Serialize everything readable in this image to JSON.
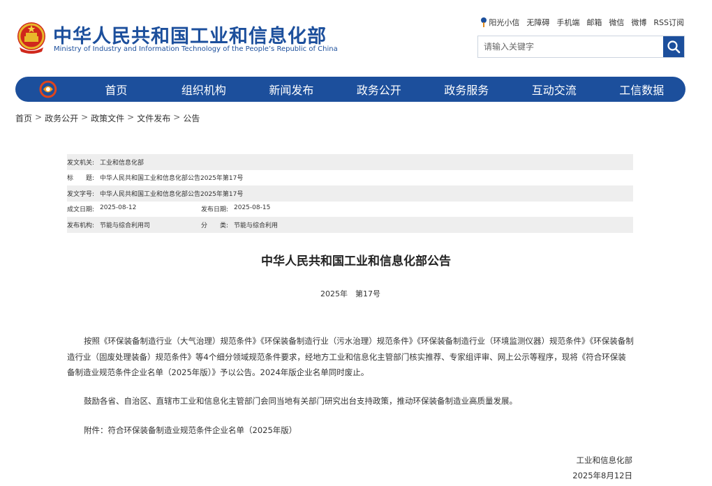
{
  "header": {
    "title_cn": "中华人民共和国工业和信息化部",
    "title_en": "Ministry of Industry and Information Technology of the People’s Republic of China",
    "emblem_icon": "national-emblem-icon"
  },
  "top_links": [
    "阳光小信",
    "无障碍",
    "手机端",
    "邮箱",
    "微信",
    "微博",
    "RSS订阅"
  ],
  "search": {
    "placeholder": "请输入关键字"
  },
  "nav": {
    "items": [
      "首页",
      "组织机构",
      "新闻发布",
      "政务公开",
      "政务服务",
      "互动交流",
      "工信数据"
    ]
  },
  "breadcrumb": [
    "首页",
    "政务公开",
    "政策文件",
    "文件发布",
    "公告"
  ],
  "info": {
    "issuer_label": "发文机关:",
    "issuer": "工业和信息化部",
    "title_label": "标　　题:",
    "title": "中华人民共和国工业和信息化部公告2025年第17号",
    "docno_label": "发文字号:",
    "docno": "中华人民共和国工业和信息化部公告2025年第17号",
    "created_label": "成文日期:",
    "created": "2025-08-12",
    "published_label": "发布日期:",
    "published": "2025-08-15",
    "org_label": "发布机构:",
    "org": "节能与综合利用司",
    "category_label": "分　　类:",
    "category": "节能与综合利用"
  },
  "doc": {
    "title": "中华人民共和国工业和信息化部公告",
    "number": "2025年　第17号",
    "para1": "按照《环保装备制造行业（大气治理）规范条件》《环保装备制造行业（污水治理）规范条件》《环保装备制造行业（环境监测仪器）规范条件》《环保装备制造行业（固废处理装备）规范条件》等4个细分领域规范条件要求，经地方工业和信息化主管部门核实推荐、专家组评审、网上公示等程序，现将《符合环保装备制造业规范条件企业名单（2025年版）》予以公告。2024年版企业名单同时废止。",
    "para2": "鼓励各省、自治区、直辖市工业和信息化主管部门会同当地有关部门研究出台支持政策，推动环保装备制造业高质量发展。",
    "attachment": "附件：符合环保装备制造业规范条件企业名单（2025年版）",
    "signer": "工业和信息化部",
    "date": "2025年8月12日"
  },
  "colors": {
    "brand_blue": "#1c4f9c",
    "row_shade": "#eeeeee"
  }
}
